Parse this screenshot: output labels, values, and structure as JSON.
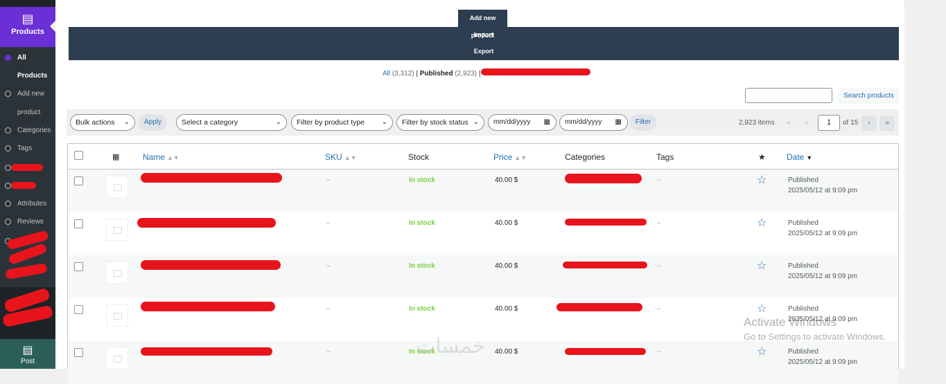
{
  "sidebar": {
    "active_menu": "Products",
    "sub_items": [
      {
        "label": "All",
        "active": true
      },
      {
        "label": "Products",
        "active": true
      },
      {
        "label": "Add new"
      },
      {
        "label": "product"
      },
      {
        "label": "Categories"
      },
      {
        "label": "Tags"
      },
      {
        "label": ""
      },
      {
        "label": ""
      },
      {
        "label": "Attributes"
      },
      {
        "label": "Reviews"
      }
    ],
    "bottom_label": "Post"
  },
  "page_actions": {
    "add_new": "Add new product",
    "import": "Import",
    "export": "Export"
  },
  "views": {
    "all_label": "All",
    "all_count": "(3,312)",
    "published_label": "Published",
    "published_count": "(2,923)",
    "separator": "|"
  },
  "search": {
    "button": "Search products",
    "value": ""
  },
  "filters": {
    "bulk_actions": "Bulk actions",
    "apply": "Apply",
    "category": "Select a category",
    "product_type": "Filter by product type",
    "stock_status": "Filter by stock status",
    "date_from": "mm/dd/yyyy",
    "date_to": "mm/dd/yyyy",
    "filter": "Filter"
  },
  "pagination": {
    "items": "2,923 items",
    "first": "«",
    "prev": "‹",
    "current": "1",
    "of": "of 15",
    "next": "›",
    "last": "»"
  },
  "columns": {
    "name": "Name",
    "sku": "SKU",
    "stock": "Stock",
    "price": "Price",
    "categories": "Categories",
    "tags": "Tags",
    "date": "Date"
  },
  "rows": [
    {
      "sku": "–",
      "stock": "In stock",
      "price": "40.00 $",
      "tags": "–",
      "status": "Published",
      "date": "2025/05/12 at 9:09 pm"
    },
    {
      "sku": "–",
      "stock": "In stock",
      "price": "40.00 $",
      "tags": "–",
      "status": "Published",
      "date": "2025/05/12 at 9:09 pm"
    },
    {
      "sku": "–",
      "stock": "In stock",
      "price": "40.00 $",
      "tags": "–",
      "status": "Published",
      "date": "2025/05/12 at 9:09 pm"
    },
    {
      "sku": "–",
      "stock": "In stock",
      "price": "40.00 $",
      "tags": "–",
      "status": "Published",
      "date": "2025/05/12 at 9:09 pm"
    },
    {
      "sku": "–",
      "stock": "In stock",
      "price": "40.00 $",
      "tags": "–",
      "status": "Published",
      "date": "2025/05/12 at 9:09 pm"
    }
  ],
  "activation": {
    "title": "Activate Windows",
    "subtitle": "Go to Settings to activate Windows."
  },
  "watermark": "خمسات",
  "colors": {
    "accent": "#6b2fd6",
    "admin_dark": "#1d2327",
    "link": "#2271b1",
    "in_stock": "#7ad03a",
    "redaction": "#e8141c"
  }
}
